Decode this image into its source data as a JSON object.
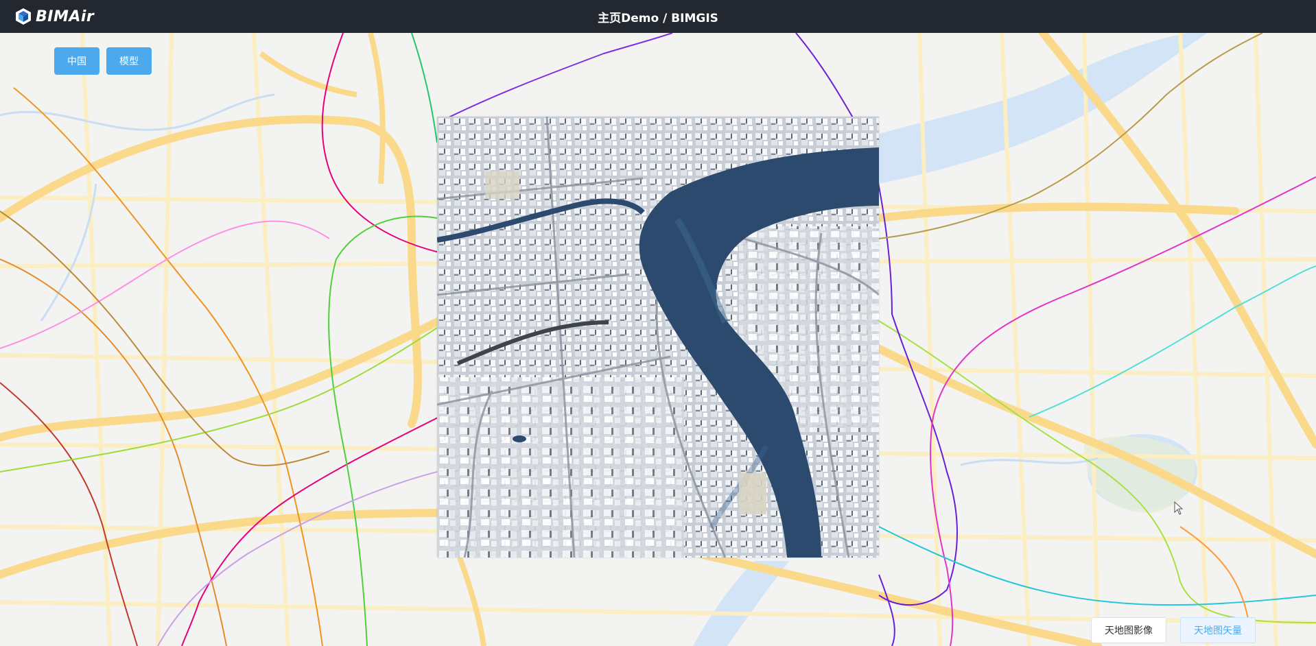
{
  "app": {
    "logo_text": "BIMAir",
    "page_title": "主页Demo / BIMGIS"
  },
  "controls": {
    "china_label": "中国",
    "model_label": "模型"
  },
  "layers": {
    "imagery_label": "天地图影像",
    "vector_label": "天地图矢量",
    "active": "vector"
  },
  "colors": {
    "header_bg": "#23272f",
    "accent": "#4da9ee",
    "river": "#2b4a6e",
    "water_basemap": "#d4e4f7",
    "road_major": "#fad98a",
    "road_minor": "#fbeec2"
  },
  "icons": {
    "logo": "bimair-cube-icon",
    "cursor": "mouse-pointer-icon"
  }
}
